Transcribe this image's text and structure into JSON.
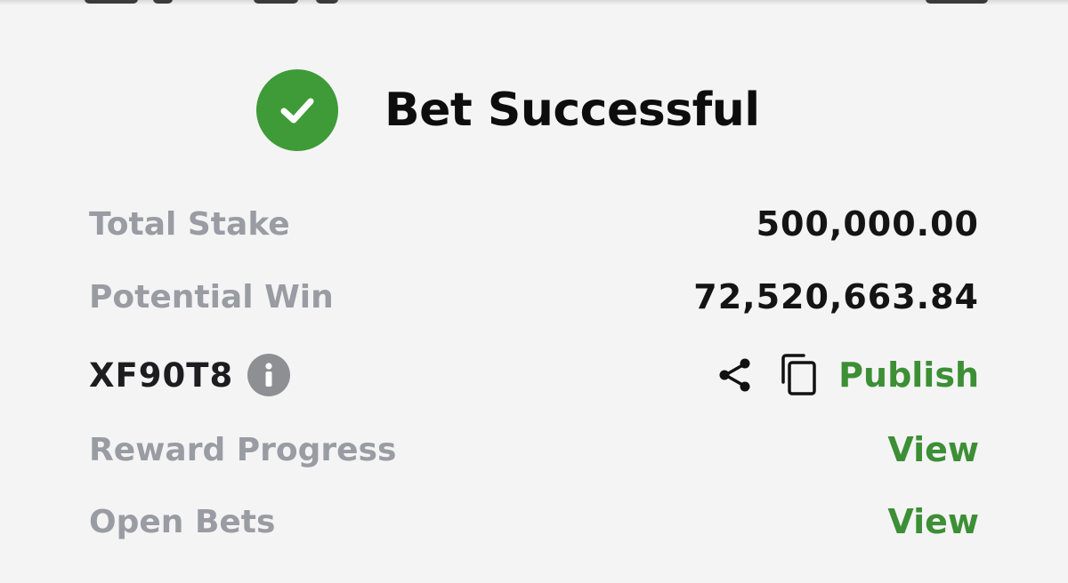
{
  "header": {
    "title": "Bet Successful"
  },
  "summary": {
    "total_stake": {
      "label": "Total Stake",
      "value": "500,000.00"
    },
    "potential_win": {
      "label": "Potential Win",
      "value": "72,520,663.84"
    }
  },
  "booking": {
    "code": "XF90T8",
    "publish_label": "Publish"
  },
  "links": {
    "reward_progress": {
      "label": "Reward Progress",
      "action": "View"
    },
    "open_bets": {
      "label": "Open Bets",
      "action": "View"
    }
  },
  "icons": {
    "status": "check-circle-icon",
    "info": "info-icon",
    "share": "share-icon",
    "copy": "copy-icon"
  },
  "colors": {
    "success_green": "#3f9b37",
    "link_green": "#3d8f35",
    "label_gray": "#9a9ca3",
    "text_dark": "#141414"
  }
}
